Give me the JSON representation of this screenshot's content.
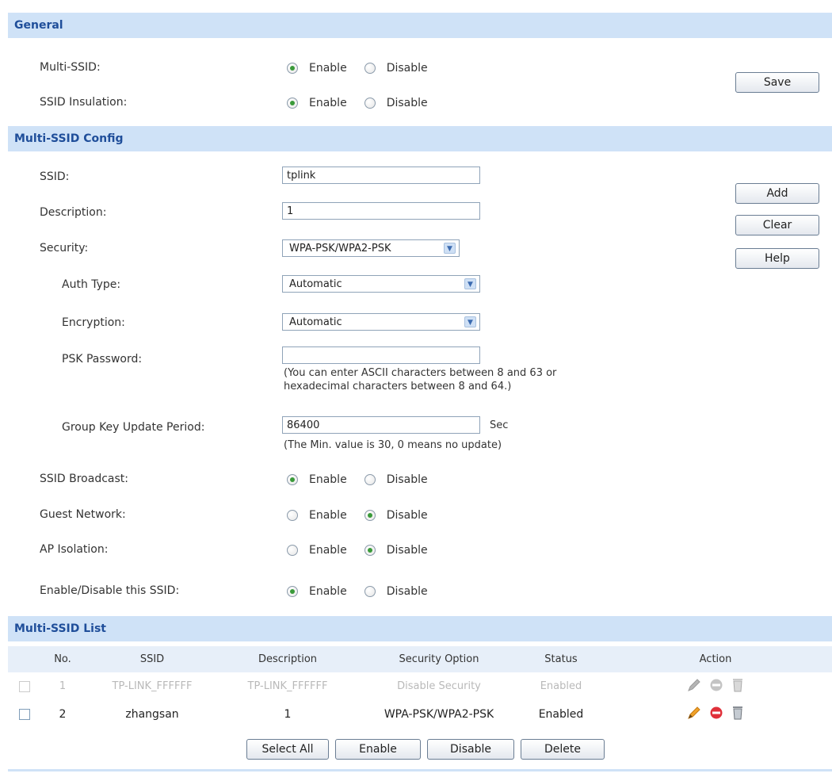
{
  "general": {
    "title": "General",
    "multi_ssid_label": "Multi-SSID:",
    "ssid_insulation_label": "SSID Insulation:",
    "enable": "Enable",
    "disable": "Disable",
    "save": "Save"
  },
  "config": {
    "title": "Multi-SSID Config",
    "ssid_label": "SSID:",
    "ssid_value": "tplink",
    "description_label": "Description:",
    "description_value": "1",
    "security_label": "Security:",
    "security_value": "WPA-PSK/WPA2-PSK",
    "auth_type_label": "Auth Type:",
    "auth_type_value": "Automatic",
    "encryption_label": "Encryption:",
    "encryption_value": "Automatic",
    "psk_label": "PSK Password:",
    "psk_value": "",
    "psk_note_1": "(You can enter ASCII characters between 8 and 63 or",
    "psk_note_2": "hexadecimal characters between 8 and 64.)",
    "gkup_label": "Group Key Update Period:",
    "gkup_value": "86400",
    "gkup_unit": "Sec",
    "gkup_note": "(The Min. value is 30, 0 means no update)",
    "ssid_broadcast_label": "SSID Broadcast:",
    "guest_network_label": "Guest Network:",
    "ap_isolation_label": "AP Isolation:",
    "enable_ssid_label": "Enable/Disable this SSID:",
    "enable": "Enable",
    "disable": "Disable",
    "add": "Add",
    "clear": "Clear",
    "help": "Help"
  },
  "list": {
    "title": "Multi-SSID List",
    "headers": {
      "no": "No.",
      "ssid": "SSID",
      "description": "Description",
      "security": "Security Option",
      "status": "Status",
      "action": "Action"
    },
    "rows": [
      {
        "no": "1",
        "ssid": "TP-LINK_FFFFFF",
        "description": "TP-LINK_FFFFFF",
        "security": "Disable Security",
        "status": "Enabled"
      },
      {
        "no": "2",
        "ssid": "zhangsan",
        "description": "1",
        "security": "WPA-PSK/WPA2-PSK",
        "status": "Enabled"
      }
    ],
    "select_all": "Select All",
    "enable": "Enable",
    "disable": "Disable",
    "delete": "Delete"
  },
  "icons": {
    "edit": "pencil-edit-icon",
    "disable": "stop-icon",
    "delete": "trash-icon"
  },
  "colors": {
    "header_bg": "#cfe2f7",
    "header_text": "#1f4e9a",
    "radio_on": "#3a9a3a",
    "stop_red": "#e0303a"
  }
}
